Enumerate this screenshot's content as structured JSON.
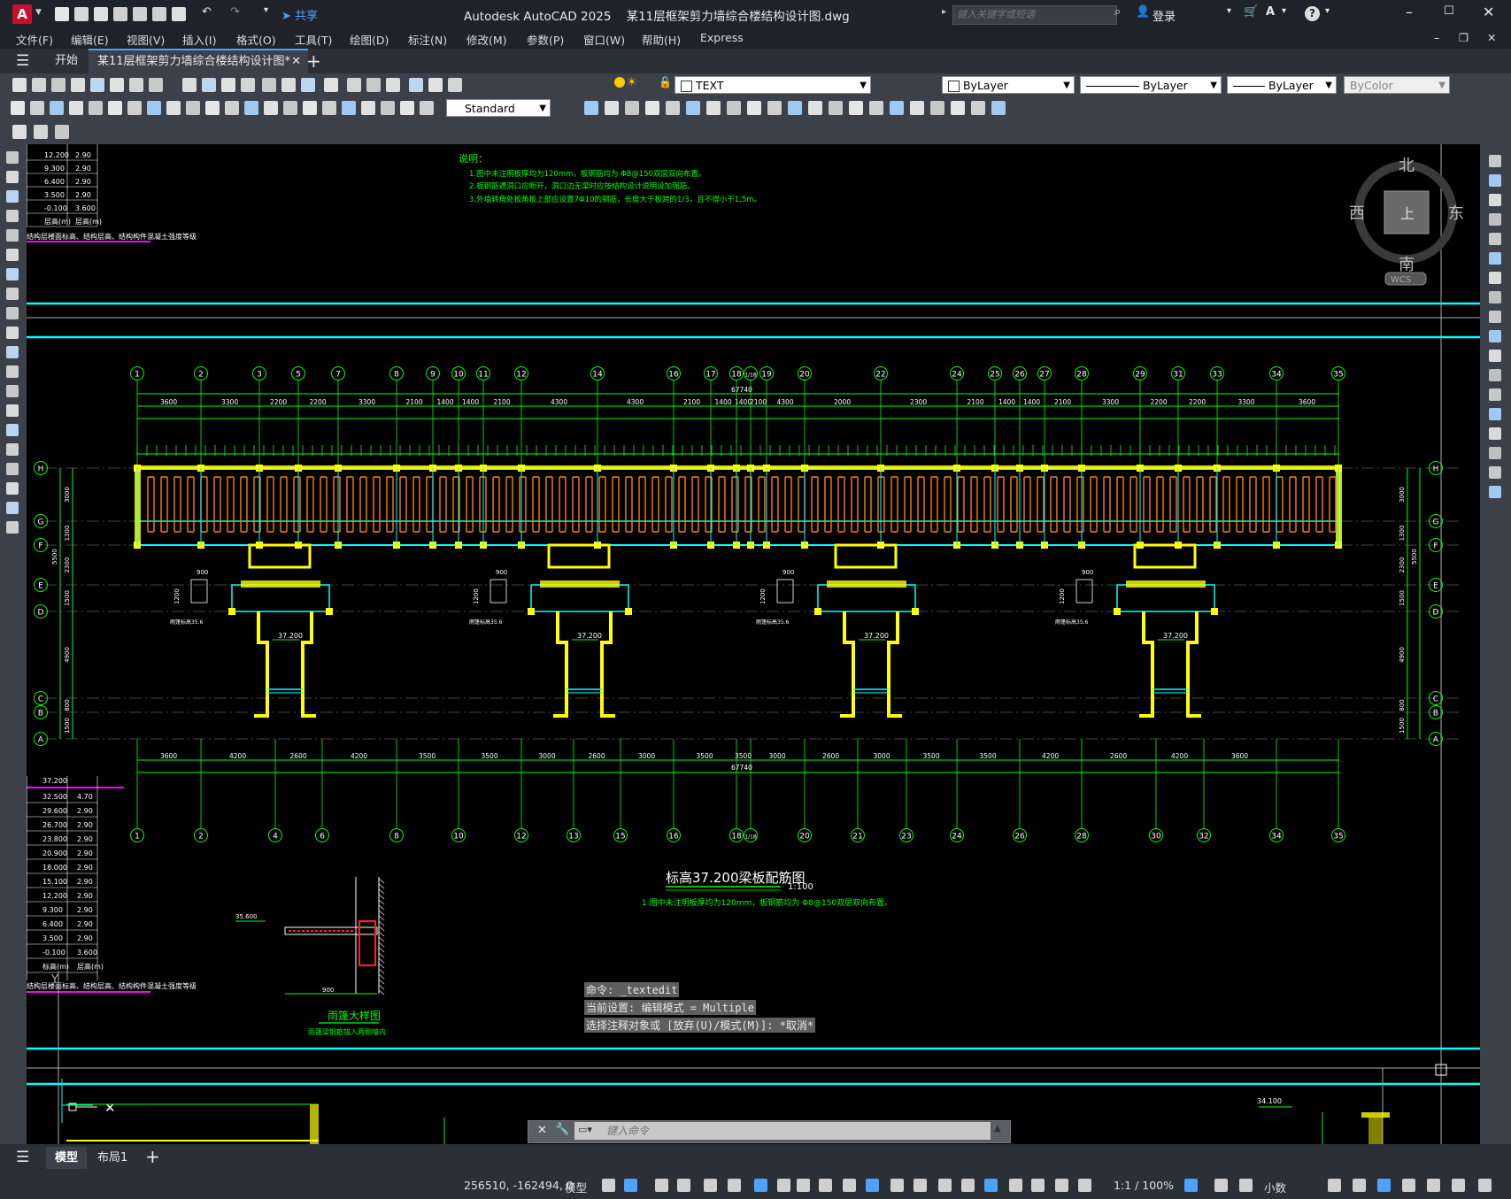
{
  "titlebar": {
    "app_icon": "A",
    "share_label": "共享",
    "title": "Autodesk AutoCAD 2025    某11层框架剪力墙综合楼结构设计图.dwg",
    "search_placeholder": "键入关键字或短语",
    "login_label": "登录"
  },
  "menu": [
    "文件(F)",
    "编辑(E)",
    "视图(V)",
    "插入(I)",
    "格式(O)",
    "工具(T)",
    "绘图(D)",
    "标注(N)",
    "修改(M)",
    "参数(P)",
    "窗口(W)",
    "帮助(H)",
    "Express"
  ],
  "tabs": {
    "start": "开始",
    "active_doc": "某11层框架剪力墙综合楼结构设计图*"
  },
  "toolbar": {
    "layer_name": "TEXT",
    "color": "ByLayer",
    "linetype": "ByLayer",
    "lineweight": "ByLayer",
    "plotstyle": "ByColor",
    "dimstyle": "Standard"
  },
  "viewcube": {
    "north": "北",
    "south": "南",
    "east": "东",
    "west": "西",
    "top": "上",
    "wcs": "WCS"
  },
  "drawing": {
    "notes_title": "说明：",
    "notes": [
      "1.图中未注明板厚均为120mm，板钢筋均为 Φ8@150双层双向布置。",
      "2.板钢筋遇洞口应断开，洞口边无梁时应按结构设计说明设加强筋。",
      "3.外墙转角处板角板上部应设置7Φ10的钢筋，长度大于板跨的1/3，且不得小于1.5m。"
    ],
    "plan_title": "标高37.200梁板配筋图",
    "plan_scale": "1:100",
    "plan_note": "1.图中未注明板厚均为120mm，板钢筋均为 Φ8@150双层双向布置。",
    "detail_title": "雨篷大样图",
    "detail_sub": "雨篷梁钢筋锚入两侧墙内",
    "total_dim": "67740",
    "axes_top": [
      "1",
      "2",
      "3",
      "5",
      "7",
      "8",
      "9",
      "10",
      "11",
      "12",
      "14",
      "16",
      "17",
      "18",
      "1/18",
      "19",
      "20",
      "22",
      "24",
      "25",
      "26",
      "27",
      "28",
      "29",
      "31",
      "33",
      "34",
      "35"
    ],
    "axes_bottom": [
      "1",
      "2",
      "4",
      "6",
      "8",
      "10",
      "12",
      "13",
      "15",
      "16",
      "18",
      "1/18",
      "20",
      "21",
      "23",
      "24",
      "26",
      "28",
      "30",
      "32",
      "34",
      "35"
    ],
    "axes_side": [
      "H",
      "G",
      "F",
      "E",
      "D",
      "C",
      "B",
      "A"
    ],
    "top_dims": [
      "3600",
      "3300",
      "2200",
      "2200",
      "3300",
      "2100",
      "1400",
      "1400",
      "2100",
      "4300",
      "4300",
      "2100",
      "1400",
      "1400",
      "2100",
      "4300",
      "2000",
      "2300",
      "2100",
      "1400",
      "1400",
      "2100",
      "3300",
      "2200",
      "2200",
      "3300",
      "3600"
    ],
    "bottom_dims": [
      "3600",
      "4200",
      "2600",
      "4200",
      "3500",
      "3500",
      "3000",
      "2600",
      "3000",
      "3500",
      "3500",
      "3000",
      "2600",
      "3000",
      "3500",
      "3500",
      "4200",
      "2600",
      "4200",
      "3600"
    ],
    "side_dims_left": [
      "3000",
      "1300",
      "2300",
      "1500",
      "4900",
      "800",
      "1500"
    ],
    "side_dims_right": [
      "3000",
      "1300",
      "2300",
      "1500",
      "4900",
      "800",
      "1500"
    ],
    "elev_label": "37.200",
    "slab_label": "5500",
    "table_top": {
      "rows": [
        [
          "12.200",
          "2.90"
        ],
        [
          "9.300",
          "2.90"
        ],
        [
          "6.400",
          "2.90"
        ],
        [
          "3.500",
          "2.90"
        ],
        [
          "-0.100",
          "3.600"
        ],
        [
          "层高(m)",
          "层高(m)"
        ]
      ],
      "caption": "结构层楼面标高、结构层高、结构构件混凝土强度等级"
    },
    "table_bottom": {
      "header": "37.200",
      "rows": [
        [
          "32.500",
          "4.70"
        ],
        [
          "29.600",
          "2.90"
        ],
        [
          "26.700",
          "2.90"
        ],
        [
          "23.800",
          "2.90"
        ],
        [
          "20.900",
          "2.90"
        ],
        [
          "18.000",
          "2.90"
        ],
        [
          "15.100",
          "2.90"
        ],
        [
          "12.200",
          "2.90"
        ],
        [
          "9.300",
          "2.90"
        ],
        [
          "6.400",
          "2.90"
        ],
        [
          "3.500",
          "2.90"
        ],
        [
          "-0.100",
          "3.600"
        ],
        [
          "标高(m)",
          "层高(m)"
        ]
      ],
      "caption": "结构层楼面标高、结构层高、结构构件混凝土强度等级"
    },
    "detail_elev": "35.600",
    "detail_dim": "900",
    "corner_elev": "34.100",
    "wall_dim_900": "900",
    "wall_dim_1200": "1200",
    "callout": "雨篷标高35.6"
  },
  "command": {
    "history": [
      "命令: _textedit",
      "当前设置: 编辑模式 = Multiple",
      "选择注释对象或 [放弃(U)/模式(M)]: *取消*"
    ],
    "placeholder": "键入命令"
  },
  "layout_tabs": [
    "模型",
    "布局1"
  ],
  "status": {
    "coords": "256510, -162494, 0",
    "model": "模型",
    "scale": "1:1 / 100%",
    "units": "小数"
  },
  "colors": {
    "green": "#00ff00",
    "cyan": "#00ffff",
    "yellow": "#ffff00",
    "orange": "#ff8000",
    "magenta": "#ff00ff",
    "red": "#ff2020"
  }
}
